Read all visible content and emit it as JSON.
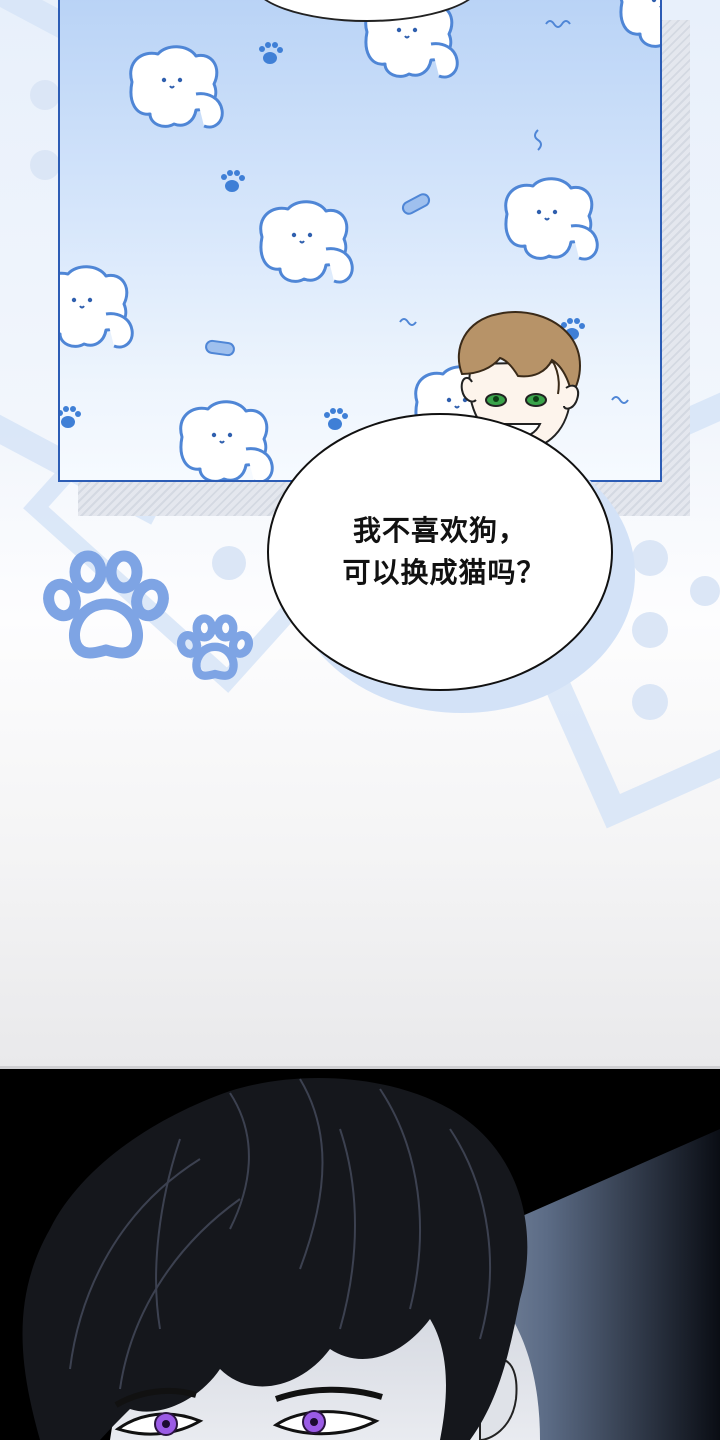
{
  "speech_bubble": {
    "line1": "我不喜欢狗，",
    "line2": "可以换成猫吗？"
  },
  "colors": {
    "panel_border": "#2c5cb5",
    "panel_sky": "#b9d3f6",
    "paw_blue": "#7ea4e4",
    "puppy_outline": "#4f86d6",
    "eye_green": "#39a34a",
    "eye_violet": "#9b5be6",
    "dark_bg": "#000000"
  },
  "icons": [
    "puppy-icon",
    "paw-icon",
    "wave-doodle-icon"
  ]
}
